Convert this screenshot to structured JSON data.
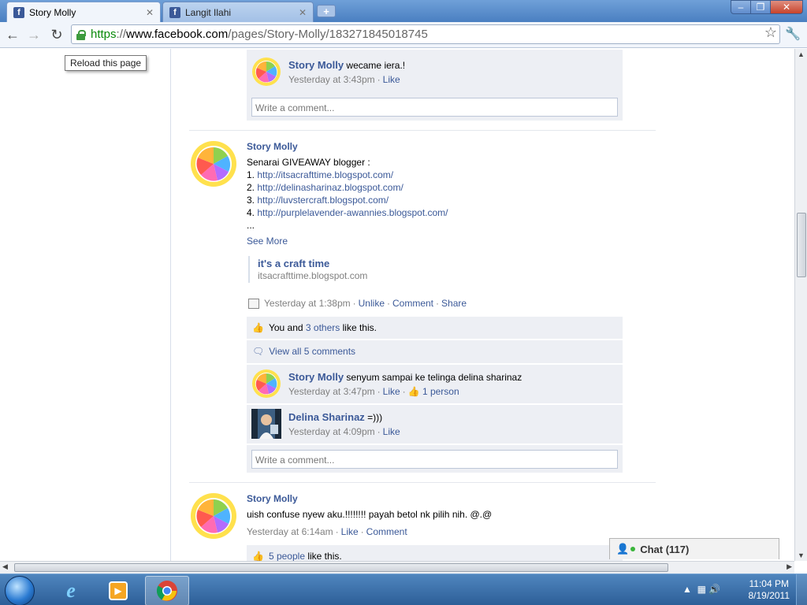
{
  "browser": {
    "tabs": [
      {
        "title": "Story Molly",
        "active": true
      },
      {
        "title": "Langit Ilahi",
        "active": false
      }
    ],
    "url": {
      "scheme": "https",
      "sep": "://",
      "host": "www.facebook.com",
      "path": "/pages/Story-Molly/183271845018745"
    },
    "tooltip": "Reload this page"
  },
  "feed": {
    "post0": {
      "comment": {
        "author": "Story Molly",
        "text": "wecame iera.!",
        "time": "Yesterday at 3:43pm",
        "like": "Like"
      },
      "write_placeholder": "Write a comment..."
    },
    "post1": {
      "author": "Story Molly",
      "lines": [
        "Senarai GIVEAWAY blogger :"
      ],
      "links": [
        {
          "num": "1.",
          "url": "http://itsacrafttime.blogspot.com/"
        },
        {
          "num": "2.",
          "url": "http://delinasharinaz.blogspot.com/"
        },
        {
          "num": "3.",
          "url": "http://luvstercraft.blogspot.com/"
        },
        {
          "num": "4.",
          "url": "http://purplelavender-awannies.blogspot.com/"
        }
      ],
      "ellipsis": "...",
      "see_more": "See More",
      "attachment": {
        "title": "it's a craft time",
        "domain": "itsacrafttime.blogspot.com"
      },
      "time": "Yesterday at 1:38pm",
      "actions": [
        "Unlike",
        "Comment",
        "Share"
      ],
      "likes": {
        "prefix": "You and",
        "link": "3 others",
        "suffix": "like this."
      },
      "view_all": "View all 5 comments",
      "comments": [
        {
          "author": "Story Molly",
          "text": "senyum sampai ke telinga delina sharinaz",
          "time": "Yesterday at 3:47pm",
          "like": "Like",
          "likes_count": "1 person"
        },
        {
          "author": "Delina Sharinaz",
          "text": "=)))",
          "time": "Yesterday at 4:09pm",
          "like": "Like"
        }
      ],
      "write_placeholder": "Write a comment..."
    },
    "post2": {
      "author": "Story Molly",
      "text": "uish confuse nyew aku.!!!!!!!! payah betol nk pilih nih. @.@",
      "time": "Yesterday at 6:14am",
      "actions": [
        "Like",
        "Comment"
      ],
      "likes": {
        "link": "5 people",
        "suffix": "like this."
      }
    }
  },
  "chat": {
    "label": "Chat",
    "count": "(117)"
  },
  "taskbar": {
    "time": "11:04 PM",
    "date": "8/19/2011"
  },
  "icons": [
    "facebook-favicon",
    "back-arrow-icon",
    "forward-arrow-icon",
    "reload-icon",
    "lock-icon",
    "star-icon",
    "wrench-icon",
    "thumbs-up-icon",
    "comment-bubble-icon",
    "status-icon",
    "chat-presence-icon",
    "windows-start-icon",
    "ie-icon",
    "media-player-icon",
    "chrome-icon"
  ],
  "colors": {
    "link": "#3b5998",
    "comment_bg": "#edeff4",
    "meta": "#808080",
    "url_secure": "#0a8a0a"
  }
}
